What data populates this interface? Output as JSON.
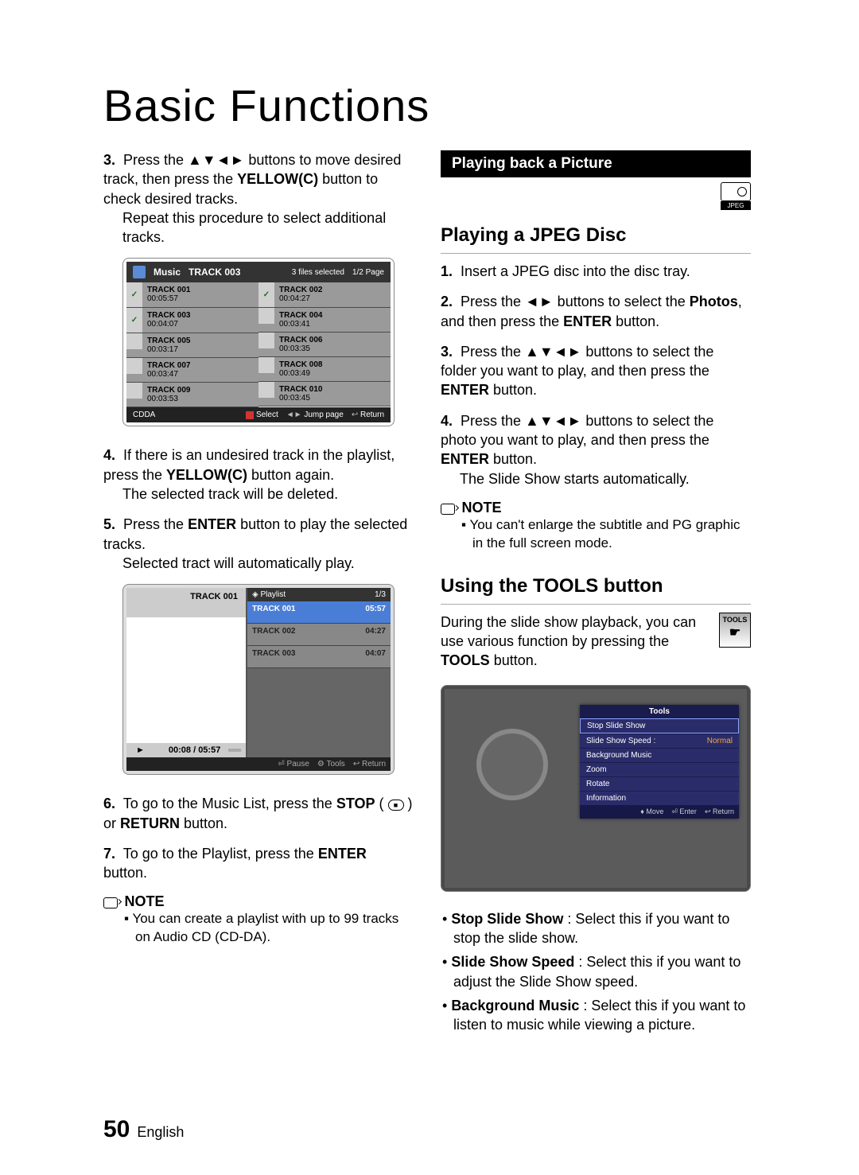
{
  "title": "Basic Functions",
  "left": {
    "step3": {
      "num": "3.",
      "text_a": "Press the ▲▼◄► buttons to move desired track, then press the ",
      "text_b": "YELLOW(C)",
      "text_c": " button to check desired tracks.",
      "text_d": "Repeat this procedure to select additional tracks."
    },
    "music_box": {
      "header_music": "Music",
      "header_track": "TRACK 003",
      "header_files": "3 files selected",
      "header_page": "1/2 Page",
      "tracks": [
        {
          "checked": true,
          "name": "TRACK 001",
          "time": "00:05:57"
        },
        {
          "checked": true,
          "name": "TRACK 003",
          "time": "00:04:07"
        },
        {
          "checked": false,
          "name": "TRACK 005",
          "time": "00:03:17"
        },
        {
          "checked": false,
          "name": "TRACK 007",
          "time": "00:03:47"
        },
        {
          "checked": false,
          "name": "TRACK 009",
          "time": "00:03:53"
        },
        {
          "checked": true,
          "name": "TRACK 002",
          "time": "00:04:27"
        },
        {
          "checked": false,
          "name": "TRACK 004",
          "time": "00:03:41"
        },
        {
          "checked": false,
          "name": "TRACK 006",
          "time": "00:03:35"
        },
        {
          "checked": false,
          "name": "TRACK 008",
          "time": "00:03:49"
        },
        {
          "checked": false,
          "name": "TRACK 010",
          "time": "00:03:45"
        }
      ],
      "footer_type": "CDDA",
      "footer_select": "Select",
      "footer_jump": "Jump page",
      "footer_return": "Return"
    },
    "step4": {
      "num": "4.",
      "text_a": "If there is an undesired track in the playlist, press the ",
      "text_b": "YELLOW(C)",
      "text_c": " button again.",
      "text_d": "The selected track will be deleted."
    },
    "step5": {
      "num": "5.",
      "text_a": "Press the ",
      "text_b": "ENTER",
      "text_c": " button to play the selected tracks.",
      "text_d": "Selected tract will automatically play."
    },
    "playlist_box": {
      "now_playing": "TRACK 001",
      "header_label": "Playlist",
      "header_page": "1/3",
      "rows": [
        {
          "name": "TRACK 001",
          "time": "05:57",
          "sel": true
        },
        {
          "name": "TRACK 002",
          "time": "04:27",
          "sel": false
        },
        {
          "name": "TRACK 003",
          "time": "04:07",
          "sel": false
        }
      ],
      "time_progress": "00:08 / 05:57",
      "play_symbol": "►",
      "footer_pause": "Pause",
      "footer_tools": "Tools",
      "footer_return": "Return"
    },
    "step6": {
      "num": "6.",
      "text_a": "To go to the Music List, press the ",
      "text_b": "STOP",
      "text_c": " ( ■ ) or ",
      "text_d": "RETURN",
      "text_e": " button."
    },
    "step7": {
      "num": "7.",
      "text_a": "To go to the Playlist, press the ",
      "text_b": "ENTER",
      "text_c": " button."
    },
    "note_label": "NOTE",
    "note_text": "You can create a playlist with up to 99 tracks on Audio CD (CD-DA)."
  },
  "right": {
    "section_title": "Playing back a Picture",
    "badge_label": "JPEG",
    "heading1": "Playing a JPEG Disc",
    "step1": {
      "num": "1.",
      "text": "Insert a JPEG disc into the disc tray."
    },
    "step2": {
      "num": "2.",
      "text_a": "Press the ◄► buttons to select the ",
      "text_b": "Photos",
      "text_c": ", and then press the ",
      "text_d": "ENTER",
      "text_e": " button."
    },
    "step3": {
      "num": "3.",
      "text_a": "Press the ▲▼◄► buttons to select the folder you want to play, and then press the ",
      "text_b": "ENTER",
      "text_c": " button."
    },
    "step4": {
      "num": "4.",
      "text_a": "Press the ▲▼◄► buttons to select the photo you want to play, and then press the ",
      "text_b": "ENTER",
      "text_c": " button.",
      "text_d": "The Slide Show starts automatically."
    },
    "note_label": "NOTE",
    "note_text": "You can't enlarge the subtitle and PG graphic in the full screen mode.",
    "heading2": "Using the TOOLS button",
    "tools_intro_a": "During the slide show playback, you can use various function by pressing the ",
    "tools_intro_b": "TOOLS",
    "tools_intro_c": " button.",
    "tools_btn_label": "TOOLS",
    "tools_panel": {
      "header": "Tools",
      "rows": [
        {
          "label": "Stop Slide Show",
          "value": ""
        },
        {
          "label": "Slide Show Speed :",
          "value": "Normal"
        },
        {
          "label": "Background Music",
          "value": ""
        },
        {
          "label": "Zoom",
          "value": ""
        },
        {
          "label": "Rotate",
          "value": ""
        },
        {
          "label": "Information",
          "value": ""
        }
      ],
      "footer_move": "Move",
      "footer_enter": "Enter",
      "footer_return": "Return"
    },
    "bullets": [
      {
        "b": "Stop Slide Show",
        "t": " : Select this if you want to stop the slide show."
      },
      {
        "b": "Slide Show Speed",
        "t": " : Select this if you want to adjust the Slide Show speed."
      },
      {
        "b": "Background Music",
        "t": " : Select this if you want to listen to music while viewing a picture."
      }
    ]
  },
  "footer": {
    "page_number": "50",
    "language": "English"
  }
}
